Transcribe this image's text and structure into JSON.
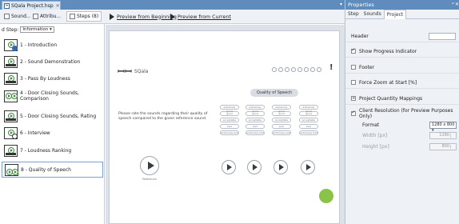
{
  "document_tab": {
    "title": "SQala Project.hsp"
  },
  "toolbar": {
    "tabs": [
      {
        "label": "Sound...",
        "selected": false
      },
      {
        "label": "Attribu...",
        "selected": false
      },
      {
        "label": "Steps (8)",
        "selected": true
      }
    ],
    "preview_beginning": "Preview from Beginning",
    "preview_current": "Preview from Current"
  },
  "steps_panel": {
    "filter_label": "d Step:",
    "filter_value": "Information",
    "items": [
      {
        "label": "1 - Introduction"
      },
      {
        "label": "2 - Sound Demonstration"
      },
      {
        "label": "3 - Pass By Loudness"
      },
      {
        "label": "4 - Door Closing Sounds, Comparison"
      },
      {
        "label": "5 - Door Closing Sounds, Rating"
      },
      {
        "label": "6 - Interview"
      },
      {
        "label": "7 - Loudness Ranking"
      },
      {
        "label": "8 - Quality of Speech",
        "active": true
      }
    ]
  },
  "slide": {
    "logo_text": "SQala",
    "page_title": "Quality of Speech",
    "instructions": "Please rate the sounds regarding their quality of speech compared to the given reference sound.",
    "scale_labels": [
      "extremely good",
      "good",
      "acceptable",
      "bad",
      "extremely bad"
    ],
    "reference_label": "Reference",
    "progress_dots": 8
  },
  "properties": {
    "title": "Properties",
    "tabs": [
      "Step",
      "Sounds",
      "Project"
    ],
    "selected_tab": "Project",
    "header_label": "Header",
    "show_progress": {
      "label": "Show Progress Indicator",
      "checked": true
    },
    "footer": {
      "label": "Footer",
      "checked": false
    },
    "force_zoom": {
      "label": "Force Zoom at Start [%]",
      "checked": false
    },
    "quantity_mappings": {
      "label": "Project Quantity Mappings"
    },
    "client_resolution": {
      "label": "Client Resolution (for Preview Purposes Only)",
      "checked": true,
      "format_label": "Format",
      "format_value": "1280 x 800",
      "width_label": "Width [px]",
      "width_value": "1280",
      "height_label": "Height [px]",
      "height_value": "800"
    }
  }
}
